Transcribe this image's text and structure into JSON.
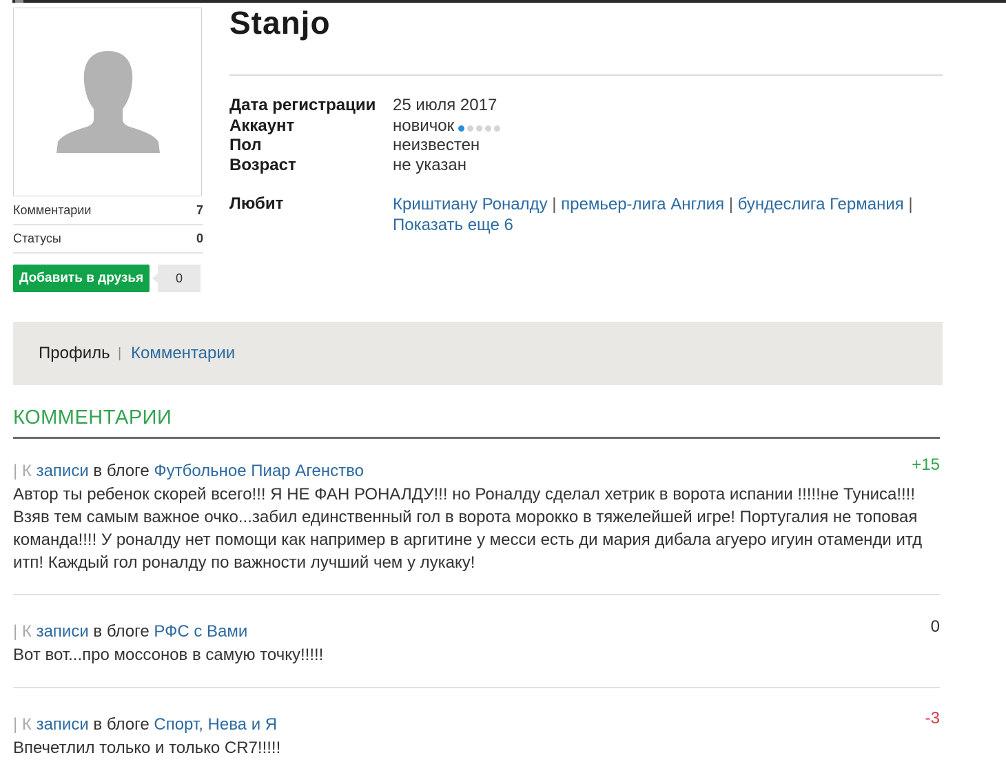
{
  "profile": {
    "username": "Stanjo",
    "stats": [
      {
        "label": "Комментарии",
        "value": "7"
      },
      {
        "label": "Статусы",
        "value": "0"
      }
    ],
    "add_friend_label": "Добавить в друзья",
    "friends_count": "0",
    "info": {
      "reg_label": "Дата регистрации",
      "reg_value": "25 июля 2017",
      "account_label": "Аккаунт",
      "account_value": "новичок",
      "account_level": 1,
      "account_level_max": 5,
      "gender_label": "Пол",
      "gender_value": "неизвестен",
      "age_label": "Возраст",
      "age_value": "не указан",
      "likes_label": "Любит",
      "likes": [
        "Криштиану Роналду",
        "премьер-лига Англия",
        "бундеслига Германия"
      ],
      "show_more": "Показать еще 6"
    }
  },
  "tabs": {
    "profile": "Профиль",
    "separator": "|",
    "comments": "Комментарии"
  },
  "section_title": "КОММЕНТАРИИ",
  "comments": [
    {
      "prefix": "| К ",
      "post_link": "записи",
      "blog_word": " в блоге ",
      "blog_name": "Футбольное Пиар Агенство",
      "score": "+15",
      "text": "Автор ты ребенок скорей всего!!! Я НЕ ФАН РОНАЛДУ!!! но Роналду сделал хетрик в ворота испании !!!!!не Туниса!!!! Взяв тем самым важное очко...забил единственный гол в ворота морокко в тяжелейшей игре! Португалия не топовая команда!!!! У роналду нет помощи как например в аргитине у месси есть ди мария дибала агуеро игуин отаменди итд итп! Каждый гол роналду по важности лучший чем у лукаку!"
    },
    {
      "prefix": "| К ",
      "post_link": "записи",
      "blog_word": " в блоге ",
      "blog_name": "РФС с Вами",
      "score": "0",
      "text": "Вот вот...про моссонов в самую точку!!!!!"
    },
    {
      "prefix": "| К ",
      "post_link": "записи",
      "blog_word": " в блоге ",
      "blog_name": "Спорт, Нева и Я",
      "score": "-3",
      "text": "Впечетлил только и только CR7!!!!!"
    }
  ],
  "colors": {
    "link": "#2c6aa0",
    "accent_green": "#33a34f",
    "button_green": "#11a34a",
    "negative": "#d6394b",
    "level_dot": "#2a8fd6"
  }
}
